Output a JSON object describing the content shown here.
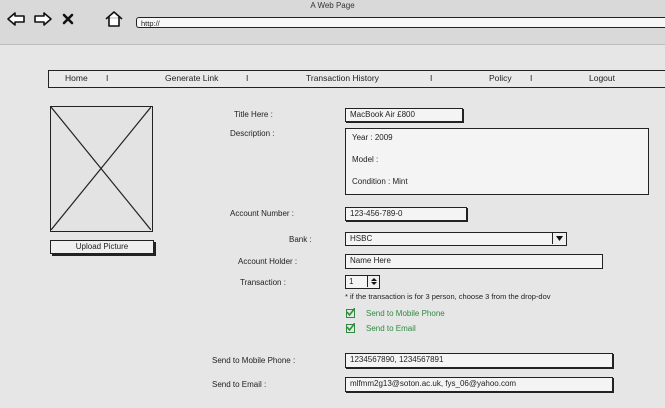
{
  "window": {
    "title": "A Web Page"
  },
  "browser": {
    "url": "http://",
    "icons": [
      "back-arrow-icon",
      "forward-arrow-icon",
      "close-icon",
      "home-icon"
    ]
  },
  "menu": {
    "items": [
      "Home",
      "Generate Link",
      "Transaction History",
      "Policy",
      "Logout"
    ],
    "separator": "I"
  },
  "upload_button": "Upload Picture",
  "form": {
    "title_label": "Title Here :",
    "title_value": "MacBook Air £800",
    "description_label": "Description :",
    "description_lines": [
      "Year : 2009",
      "Model :",
      "Condition : Mint"
    ],
    "account_number_label": "Account Number :",
    "account_number_value": "123-456-789-0",
    "bank_label": "Bank :",
    "bank_value": "HSBC",
    "account_holder_label": "Account Holder :",
    "account_holder_value": "Name Here",
    "transaction_label": "Transaction :",
    "transaction_value": "1",
    "transaction_note": "* if the transaction is for 3 person, choose 3 from the drop-dov",
    "send_mobile_checkbox": "Send to Mobile Phone",
    "send_email_checkbox": "Send to Email",
    "mobile_label": "Send to Mobile Phone :",
    "mobile_value": "1234567890, 1234567891",
    "email_label": "Send to Email :",
    "email_value": "mlfmm2g13@soton.ac.uk, fys_06@yahoo.com"
  },
  "colors": {
    "check_green": "#2e8b3e"
  }
}
